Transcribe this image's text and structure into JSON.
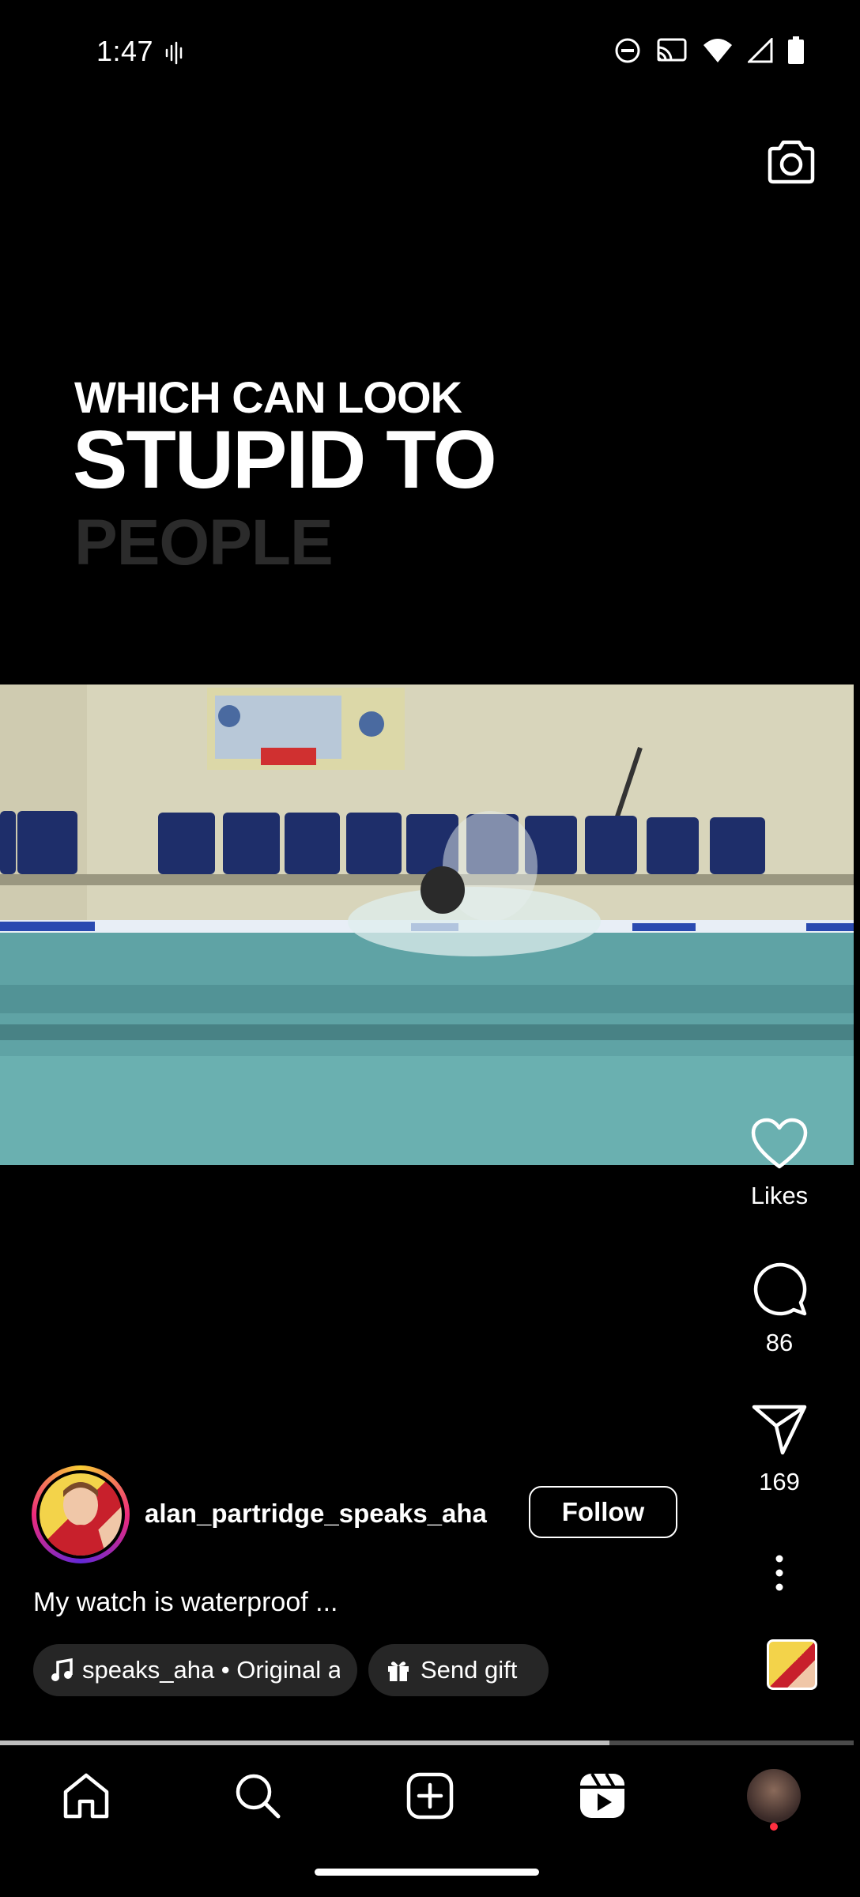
{
  "status_bar": {
    "time": "1:47",
    "icons": [
      "sound-wave-icon",
      "do-not-disturb-icon",
      "cast-icon",
      "wifi-icon",
      "cellular-signal-icon",
      "battery-icon"
    ]
  },
  "top_bar": {
    "camera_icon": "camera-icon"
  },
  "video_caption": {
    "line1": "WHICH CAN LOOK",
    "line2": "STUPID TO",
    "line3": "PEOPLE"
  },
  "actions": {
    "like_label": "Likes",
    "comment_count": "86",
    "share_count": "169",
    "more_icon": "more-vertical-icon"
  },
  "author": {
    "username": "alan_partridge_speaks_aha",
    "follow_label": "Follow"
  },
  "description": "My watch is waterproof ...",
  "audio": {
    "label": "speaks_aha • Original au"
  },
  "gift": {
    "label": "Send gift"
  },
  "progress": {
    "fraction": 0.714
  },
  "colors": {
    "background": "#000000",
    "pill_bg": "#262626",
    "notification_dot": "#ff3040",
    "pool_water": "#5fa1a3"
  },
  "bottom_nav": {
    "items": [
      "home-icon",
      "search-icon",
      "create-icon",
      "reels-icon",
      "profile-avatar"
    ]
  }
}
